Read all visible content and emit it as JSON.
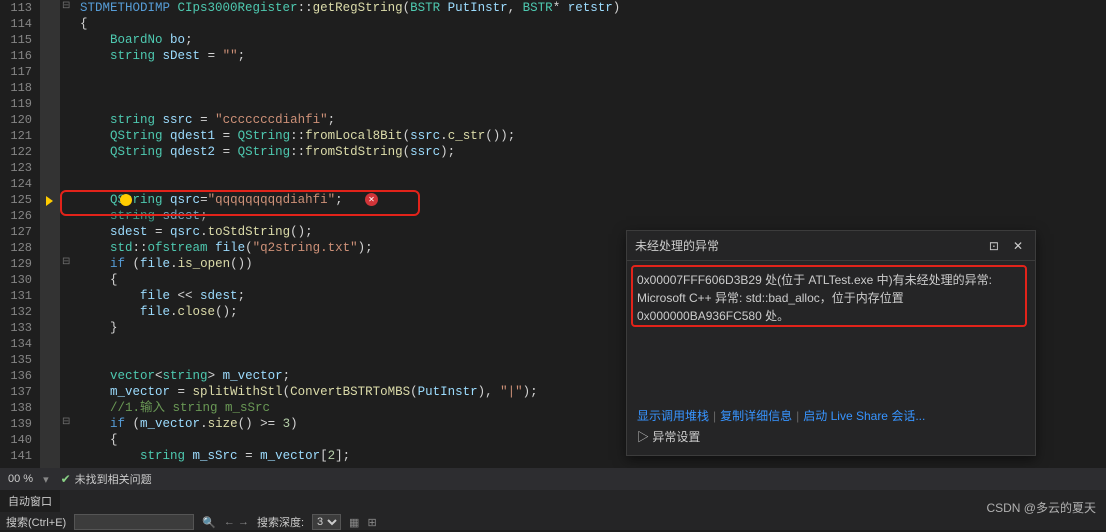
{
  "lines": {
    "start": 113,
    "end": 141
  },
  "code": {
    "l113": "STDMETHODIMP CIps3000Register::getRegString(BSTR PutInstr, BSTR* retstr)",
    "l114": "{",
    "l115": "    BoardNo bo;",
    "l116": "    string sDest = \"\";",
    "l117": "",
    "l118": "",
    "l119": "",
    "l120": "    string ssrc = \"cccccccdiahfi\";",
    "l121": "    QString qdest1 = QString::fromLocal8Bit(ssrc.c_str());",
    "l122": "    QString qdest2 = QString::fromStdString(ssrc);",
    "l123": "",
    "l124": "",
    "l125": "    QString qsrc=\"qqqqqqqqqdiahfi\";",
    "l126": "    string sdest;",
    "l127": "    sdest = qsrc.toStdString();",
    "l128": "    std::ofstream file(\"q2string.txt\");",
    "l129": "    if (file.is_open())",
    "l130": "    {",
    "l131": "        file << sdest;",
    "l132": "        file.close();",
    "l133": "    }",
    "l134": "",
    "l135": "",
    "l136": "    vector<string> m_vector;",
    "l137": "    m_vector = splitWithStl(ConvertBSTRToMBS(PutInstr), \"|\");",
    "l138": "    //1.输入 string m_sSrc",
    "l139": "    if (m_vector.size() >= 3)",
    "l140": "    {",
    "l141": "        string m_sSrc = m_vector[2];"
  },
  "exception": {
    "title": "未经处理的异常",
    "msg_l1": "0x00007FFF606D3B29 处(位于 ATLTest.exe 中)有未经处理的异常:",
    "msg_l2": "Microsoft C++ 异常: std::bad_alloc，位于内存位置",
    "msg_l3": "0x000000BA936FC580 处。",
    "link1": "显示调用堆栈",
    "link2": "复制详细信息",
    "link3": "启动 Live Share 会话...",
    "expand": "▷ 异常设置"
  },
  "status": {
    "zoom": "00 %",
    "issues": "未找到相关问题"
  },
  "bottom": {
    "tab": "自动窗口",
    "search_label": "搜索(Ctrl+E)",
    "search_placeholder": "",
    "depth_label": "搜索深度:",
    "depth_value": "3"
  },
  "watermark": "CSDN @多云的夏天"
}
